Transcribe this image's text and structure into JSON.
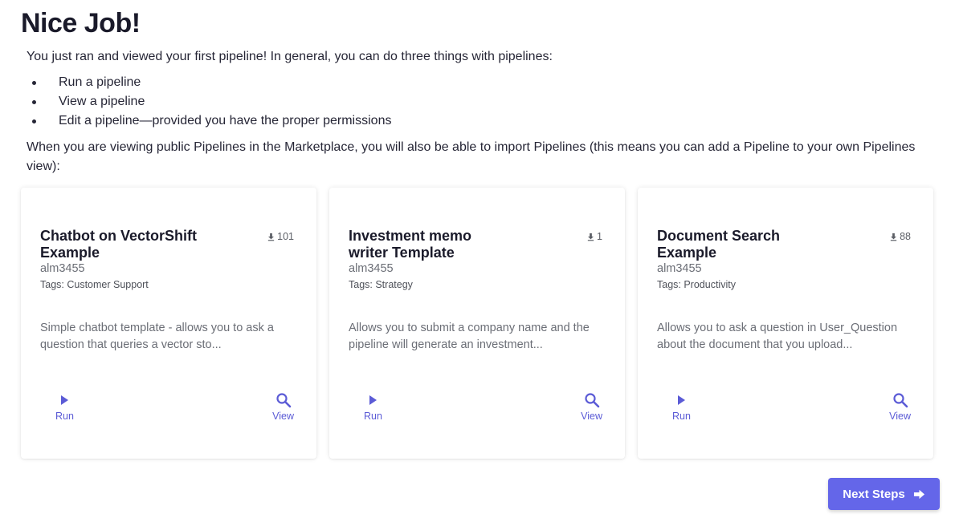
{
  "title": "Nice Job!",
  "intro": "You just ran and viewed your first pipeline! In general, you can do three things with pipelines:",
  "bullets": [
    "Run a pipeline",
    "View a pipeline",
    "Edit a pipeline—provided you have the proper permissions"
  ],
  "paragraph": "When you are viewing public Pipelines in the Marketplace, you will also be able to import Pipelines (this means you can add a Pipeline to your own Pipelines view):",
  "cards": [
    {
      "title": "Chatbot on VectorShift Example",
      "downloads": "101",
      "author": "alm3455",
      "tags": "Tags: Customer Support",
      "description": "Simple chatbot template - allows you to ask a question that queries a vector sto...",
      "run_label": "Run",
      "view_label": "View"
    },
    {
      "title": "Investment memo writer Template",
      "downloads": "1",
      "author": "alm3455",
      "tags": "Tags: Strategy",
      "description": "Allows you to submit a company name and the pipeline will generate an investment...",
      "run_label": "Run",
      "view_label": "View"
    },
    {
      "title": "Document Search Example",
      "downloads": "88",
      "author": "alm3455",
      "tags": "Tags: Productivity",
      "description": "Allows you to ask a question in User_Question about the document that you upload...",
      "run_label": "Run",
      "view_label": "View"
    }
  ],
  "next_button": {
    "label": "Next Steps",
    "icon": "arrow-right-icon"
  },
  "icons": {
    "download": "download-icon",
    "run": "play-icon",
    "view": "search-icon"
  },
  "colors": {
    "accent": "#6466e9",
    "action": "#5b5bd6",
    "text": "#1a1a2a",
    "muted": "#6b6e76"
  }
}
